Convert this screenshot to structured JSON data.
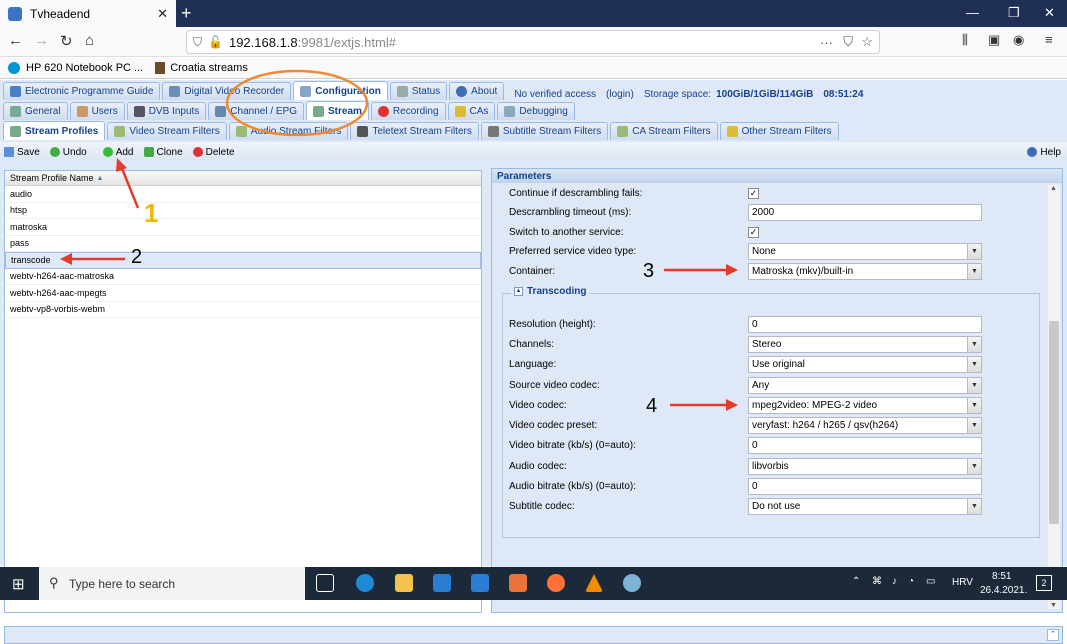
{
  "browser": {
    "tab_title": "Tvheadend",
    "url_host": "192.168.1.8",
    "url_rest": ":9981/extjs.html#",
    "bookmarks": [
      "HP 620 Notebook PC ...",
      "Croatia streams"
    ]
  },
  "main_tabs": [
    {
      "label": "Electronic Programme Guide"
    },
    {
      "label": "Digital Video Recorder"
    },
    {
      "label": "Configuration"
    },
    {
      "label": "Status"
    },
    {
      "label": "About"
    }
  ],
  "status_info": {
    "access": "No verified access",
    "login": "(login)",
    "storage_label": "Storage space:",
    "storage_value": "100GiB/1GiB/114GiB",
    "time": "08:51:24"
  },
  "config_tabs": [
    {
      "label": "General"
    },
    {
      "label": "Users"
    },
    {
      "label": "DVB Inputs"
    },
    {
      "label": "Channel / EPG"
    },
    {
      "label": "Stream"
    },
    {
      "label": "Recording"
    },
    {
      "label": "CAs"
    },
    {
      "label": "Debugging"
    }
  ],
  "stream_tabs": [
    {
      "label": "Stream Profiles"
    },
    {
      "label": "Video Stream Filters"
    },
    {
      "label": "Audio Stream Filters"
    },
    {
      "label": "Teletext Stream Filters"
    },
    {
      "label": "Subtitle Stream Filters"
    },
    {
      "label": "CA Stream Filters"
    },
    {
      "label": "Other Stream Filters"
    }
  ],
  "toolbar": {
    "save": "Save",
    "undo": "Undo",
    "add": "Add",
    "clone": "Clone",
    "delete": "Delete",
    "help": "Help"
  },
  "grid": {
    "header": "Stream Profile Name",
    "rows": [
      "audio",
      "htsp",
      "matroska",
      "pass",
      "transcode",
      "webtv-h264-aac-matroska",
      "webtv-h264-aac-mpegts",
      "webtv-vp8-vorbis-webm"
    ]
  },
  "params": {
    "title": "Parameters",
    "fields": [
      {
        "label": "Continue if descrambling fails:",
        "value": "checked"
      },
      {
        "label": "Descrambling timeout (ms):",
        "value": "2000"
      },
      {
        "label": "Switch to another service:",
        "value": "checked"
      },
      {
        "label": "Preferred service video type:",
        "value": "None"
      },
      {
        "label": "Container:",
        "value": "Matroska (mkv)/built-in"
      }
    ],
    "transcoding_title": "Transcoding",
    "transcoding": [
      {
        "label": "Resolution (height):",
        "value": "0"
      },
      {
        "label": "Channels:",
        "value": "Stereo"
      },
      {
        "label": "Language:",
        "value": "Use original"
      },
      {
        "label": "Source video codec:",
        "value": "Any"
      },
      {
        "label": "Video codec:",
        "value": "mpeg2video: MPEG-2 video"
      },
      {
        "label": "Video codec preset:",
        "value": "veryfast: h264 / h265 / qsv(h264)"
      },
      {
        "label": "Video bitrate (kb/s) (0=auto):",
        "value": "0"
      },
      {
        "label": "Audio codec:",
        "value": "libvorbis"
      },
      {
        "label": "Audio bitrate (kb/s) (0=auto):",
        "value": "0"
      },
      {
        "label": "Subtitle codec:",
        "value": "Do not use"
      }
    ]
  },
  "annotations": {
    "n1": "1",
    "n2": "2",
    "n3": "3",
    "n4": "4",
    "accent": "#e53b2c",
    "highlight": "#ef8a2e"
  },
  "taskbar": {
    "search_placeholder": "Type here to search",
    "lang": "HRV",
    "time": "8:51",
    "date": "26.4.2021.",
    "notification_count": "2"
  }
}
